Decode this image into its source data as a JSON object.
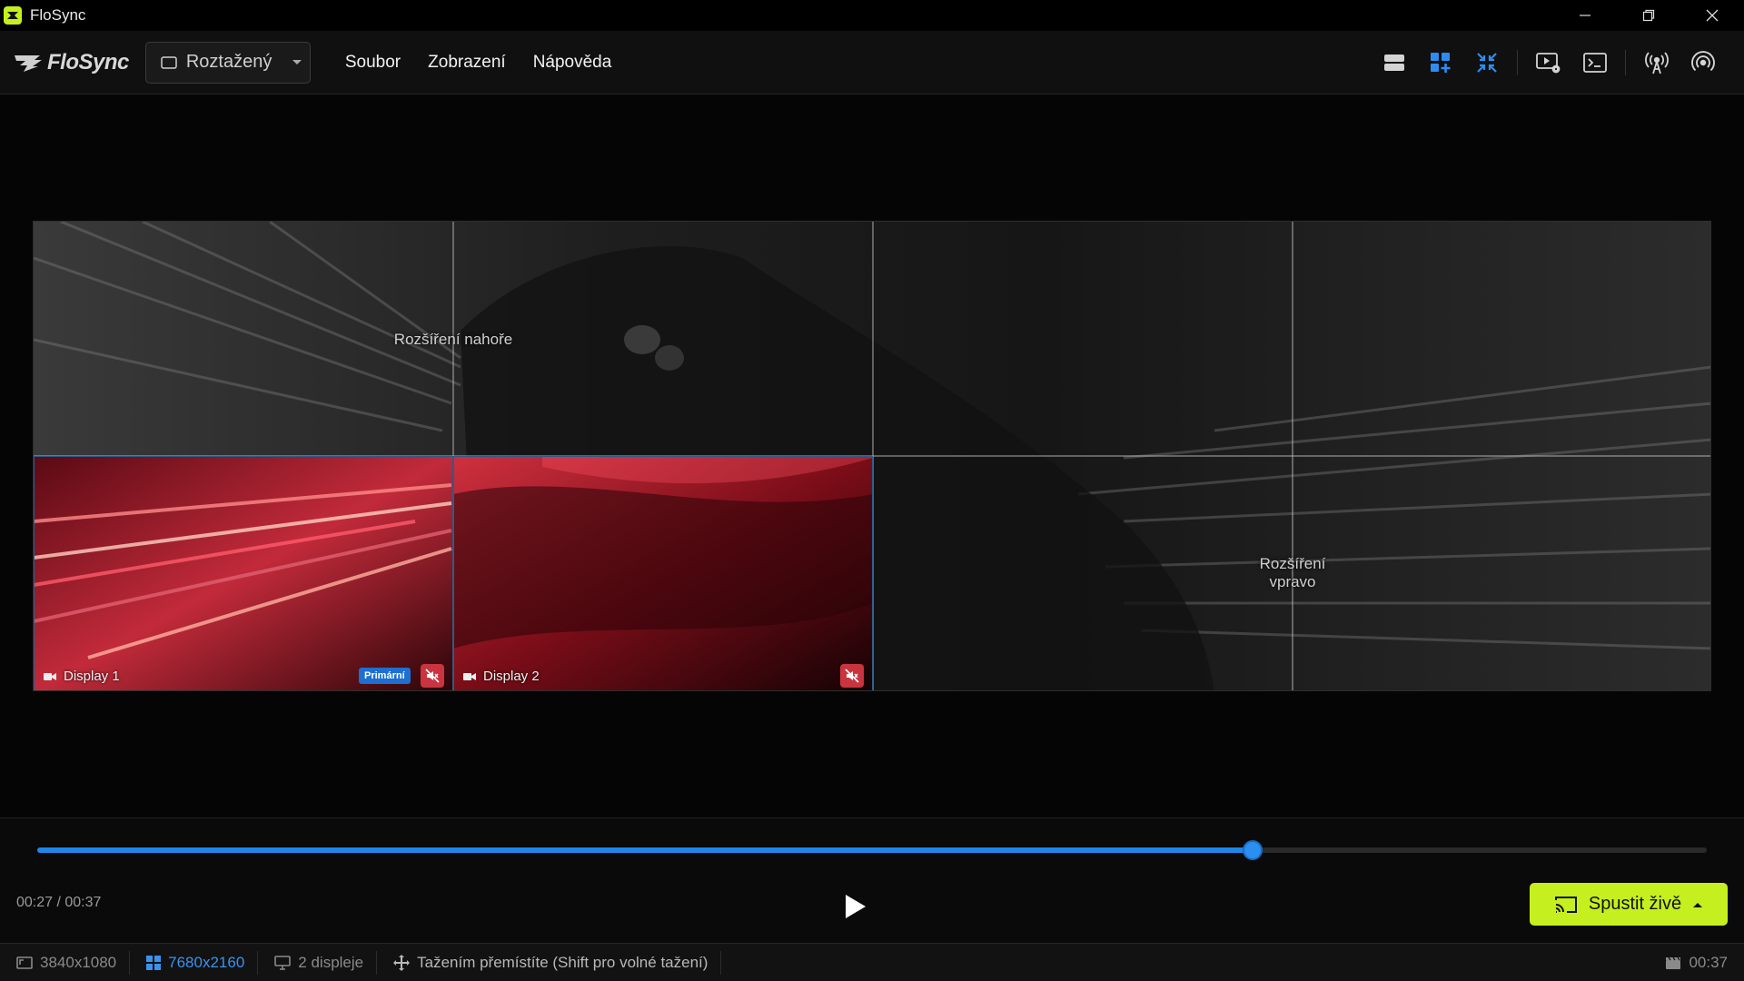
{
  "window": {
    "title": "FloSync"
  },
  "menubar": {
    "logo_text": "FloSync",
    "mode_select": {
      "value": "Roztažený"
    },
    "menu": [
      {
        "label": "Soubor"
      },
      {
        "label": "Zobrazení"
      },
      {
        "label": "Nápověda"
      }
    ],
    "toolbar": [
      {
        "icon": "rows-layout-icon",
        "active": false
      },
      {
        "icon": "grid-add-icon",
        "active": true
      },
      {
        "icon": "fit-compress-icon",
        "active": true
      },
      {
        "icon": "play-settings-icon",
        "active": false
      },
      {
        "icon": "terminal-icon",
        "active": false
      },
      {
        "icon": "broadcast-tower-icon",
        "active": false
      },
      {
        "icon": "wireless-signal-icon",
        "active": false
      }
    ]
  },
  "canvas": {
    "extension_top_label": "Rozšíření nahoře",
    "extension_right_label_line1": "Rozšíření",
    "extension_right_label_line2": "vpravo",
    "displays": [
      {
        "name": "Display 1",
        "primary_badge": "Primární",
        "muted": true
      },
      {
        "name": "Display 2",
        "muted": true
      }
    ]
  },
  "playback": {
    "progress": 0.728,
    "time_current": "00:27",
    "time_total": "00:37",
    "time_readout": "00:27 / 00:37",
    "live_button": "Spustit živě"
  },
  "statusbar": {
    "source_resolution": "3840x1080",
    "canvas_resolution": "7680x2160",
    "displays_count": "2 displeje",
    "drag_hint": "Tažením přemístíte (Shift pro volné tažení)",
    "duration": "00:37"
  },
  "colors": {
    "accent": "#1f86e6",
    "live": "#c6ef1f",
    "mute": "#c9343f",
    "primary_badge": "#1d6fd1"
  }
}
